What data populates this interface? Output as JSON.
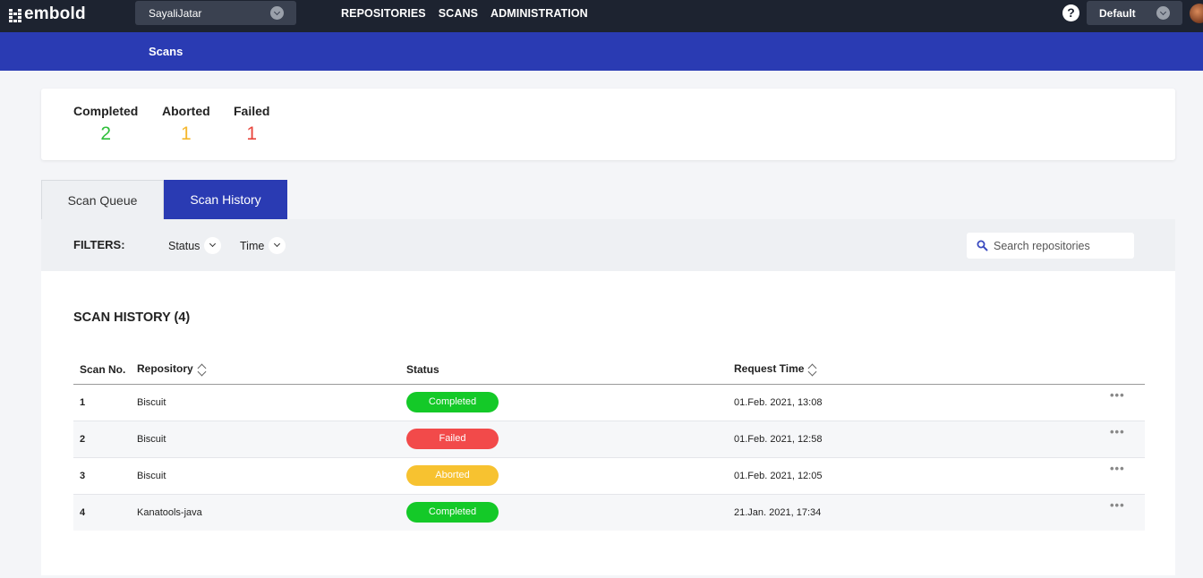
{
  "app": {
    "logo_text": "embold",
    "user": "SayaliJatar",
    "nav": [
      "REPOSITORIES",
      "SCANS",
      "ADMINISTRATION"
    ],
    "help_glyph": "?",
    "profile": "Default"
  },
  "page": {
    "title": "Scans"
  },
  "summary": [
    {
      "label": "Completed",
      "value": "2",
      "color": "#2fbf3a"
    },
    {
      "label": "Aborted",
      "value": "1",
      "color": "#f5b72c"
    },
    {
      "label": "Failed",
      "value": "1",
      "color": "#e8453c"
    }
  ],
  "tabs": [
    {
      "label": "Scan Queue",
      "active": false
    },
    {
      "label": "Scan History",
      "active": true
    }
  ],
  "filters": {
    "label": "FILTERS:",
    "status": "Status",
    "time": "Time",
    "search_placeholder": "Search repositories"
  },
  "history": {
    "title": "SCAN HISTORY (4)",
    "columns": {
      "scan_no": "Scan No.",
      "repository": "Repository",
      "status": "Status",
      "request_time": "Request Time"
    },
    "more_glyph": "•••",
    "rows": [
      {
        "scan_no": "1",
        "repository": "Biscuit",
        "status": "Completed",
        "status_color": "#14c928",
        "request_time": "01.Feb. 2021, 13:08"
      },
      {
        "scan_no": "2",
        "repository": "Biscuit",
        "status": "Failed",
        "status_color": "#f24a4a",
        "request_time": "01.Feb. 2021, 12:58"
      },
      {
        "scan_no": "3",
        "repository": "Biscuit",
        "status": "Aborted",
        "status_color": "#f7c230",
        "request_time": "01.Feb. 2021, 12:05"
      },
      {
        "scan_no": "4",
        "repository": "Kanatools-java",
        "status": "Completed",
        "status_color": "#14c928",
        "request_time": "21.Jan. 2021, 17:34"
      }
    ]
  }
}
